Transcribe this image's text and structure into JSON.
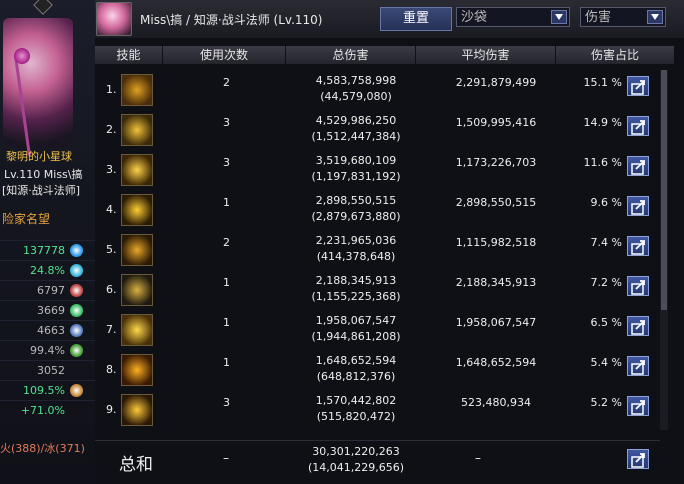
{
  "left_panel": {
    "title": "黎明的小星球",
    "level_name": "Lv.110 Miss\\搞",
    "class": "[知源·战斗法师]",
    "section": "险家名望",
    "stats": [
      {
        "value": "137778",
        "color": "#4fe38f",
        "dot": "#2f9be6"
      },
      {
        "value": "24.8%",
        "color": "#4fe38f",
        "dot": "#3ab7d9"
      },
      {
        "value": "6797",
        "color": "#b8b8b8",
        "dot": "#c34a4a"
      },
      {
        "value": "3669",
        "color": "#b8b8b8",
        "dot": "#3fbf6a"
      },
      {
        "value": "4663",
        "color": "#b8b8b8",
        "dot": "#5a7fbf"
      },
      {
        "value": "99.4%",
        "color": "#b8b8b8",
        "dot": "#4a9f3a"
      },
      {
        "value": "3052",
        "color": "#b8b8b8",
        "dot": ""
      },
      {
        "value": "109.5%",
        "color": "#4fe38f",
        "dot": "#c98a3a"
      },
      {
        "value": "+71.0%",
        "color": "#4fe38f",
        "dot": ""
      }
    ],
    "elements": "火(388)/冰(371)"
  },
  "header": {
    "title": "Miss\\搞 / 知源·战斗法师 (Lv.110)",
    "reset_label": "重置",
    "target_value": "沙袋",
    "metric_value": "伤害"
  },
  "table": {
    "headers": [
      "技能",
      "使用次数",
      "总伤害",
      "平均伤害",
      "伤害占比"
    ],
    "rows": [
      {
        "num": "1.",
        "uses": "2",
        "total": "4,583,758,998",
        "total_sub": "(44,579,080)",
        "avg": "2,291,879,499",
        "pct": "15.1 %",
        "icon": "skill-icon-1",
        "c1": "#e0a020",
        "c2": "#4a2d0a"
      },
      {
        "num": "2.",
        "uses": "3",
        "total": "4,529,986,250",
        "total_sub": "(1,512,447,384)",
        "avg": "1,509,995,416",
        "pct": "14.9 %",
        "icon": "skill-icon-2",
        "c1": "#f2c13a",
        "c2": "#3a2a0a"
      },
      {
        "num": "3.",
        "uses": "3",
        "total": "3,519,680,109",
        "total_sub": "(1,197,831,192)",
        "avg": "1,173,226,703",
        "pct": "11.6 %",
        "icon": "skill-icon-3",
        "c1": "#ffd24a",
        "c2": "#3a2605"
      },
      {
        "num": "4.",
        "uses": "1",
        "total": "2,898,550,515",
        "total_sub": "(2,879,673,880)",
        "avg": "2,898,550,515",
        "pct": "9.6 %",
        "icon": "skill-icon-4",
        "c1": "#ffcc33",
        "c2": "#2a1c05"
      },
      {
        "num": "5.",
        "uses": "2",
        "total": "2,231,965,036",
        "total_sub": "(414,378,648)",
        "avg": "1,115,982,518",
        "pct": "7.4 %",
        "icon": "skill-icon-5",
        "c1": "#e8a628",
        "c2": "#2a1a05"
      },
      {
        "num": "6.",
        "uses": "1",
        "total": "2,188,345,913",
        "total_sub": "(1,155,225,368)",
        "avg": "2,188,345,913",
        "pct": "7.2 %",
        "icon": "skill-icon-6",
        "c1": "#d9b040",
        "c2": "#1e1a10"
      },
      {
        "num": "7.",
        "uses": "1",
        "total": "1,958,067,547",
        "total_sub": "(1,944,861,208)",
        "avg": "1,958,067,547",
        "pct": "6.5 %",
        "icon": "skill-icon-7",
        "c1": "#ffd94a",
        "c2": "#4a3008"
      },
      {
        "num": "8.",
        "uses": "1",
        "total": "1,648,652,594",
        "total_sub": "(648,812,376)",
        "avg": "1,648,652,594",
        "pct": "5.4 %",
        "icon": "skill-icon-8",
        "c1": "#ffb020",
        "c2": "#3a1a05"
      },
      {
        "num": "9.",
        "uses": "3",
        "total": "1,570,442,802",
        "total_sub": "(515,820,472)",
        "avg": "523,480,934",
        "pct": "5.2 %",
        "icon": "skill-icon-9",
        "c1": "#ffc83a",
        "c2": "#2a1805"
      }
    ],
    "total": {
      "label": "总和",
      "uses": "–",
      "total": "30,301,220,263",
      "total_sub": "(14,041,229,656)",
      "avg": "–"
    }
  }
}
